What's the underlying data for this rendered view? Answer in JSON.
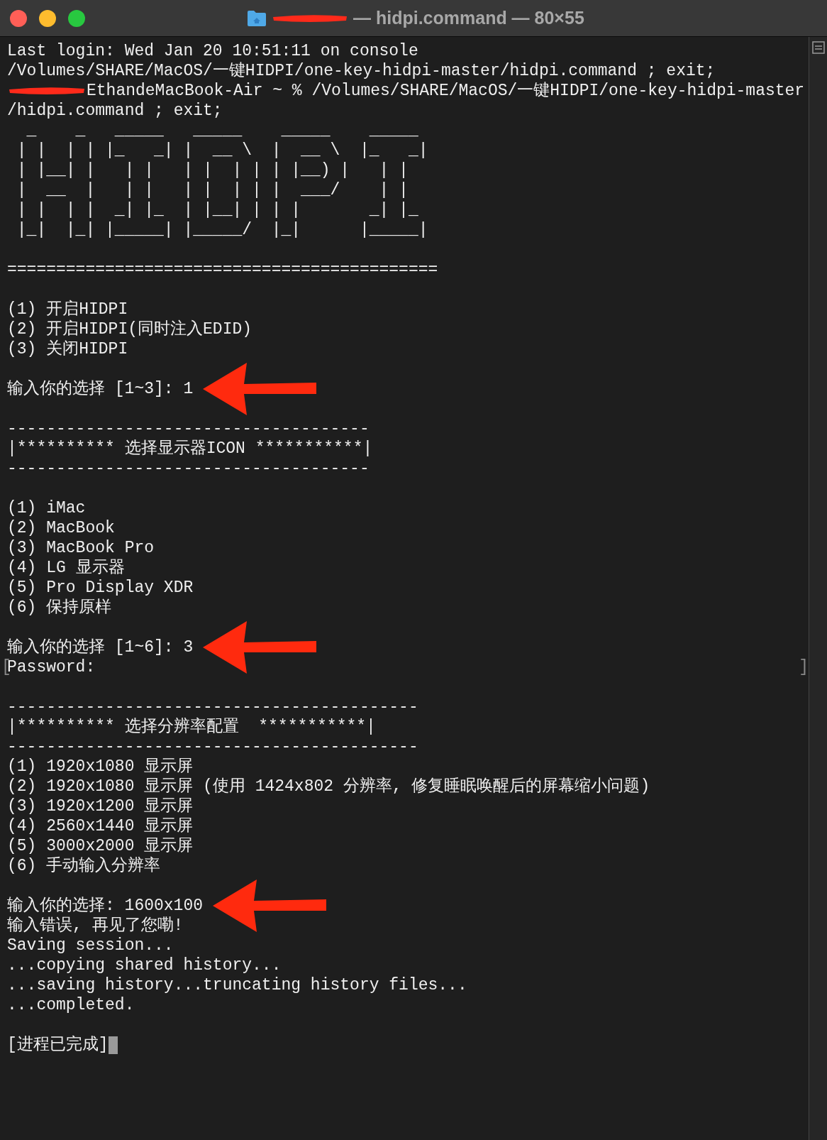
{
  "window": {
    "title": "— hidpi.command — 80×55",
    "title_redacted": true
  },
  "terminal": {
    "lines": [
      {
        "kind": "text",
        "text": "Last login: Wed Jan 20 10:51:11 on console"
      },
      {
        "kind": "text",
        "text": "/Volumes/SHARE/MacOS/一键HIDPI/one-key-hidpi-master/hidpi.command ; exit;"
      },
      {
        "kind": "redacted",
        "text": "EthandeMacBook-Air ~ % /Volumes/SHARE/MacOS/一键HIDPI/one-key-hidpi-master"
      },
      {
        "kind": "text",
        "text": "/hidpi.command ; exit;"
      },
      {
        "kind": "text",
        "text": "  _    _   _____   _____    _____    _____"
      },
      {
        "kind": "text",
        "text": " | |  | | |_   _| |  __ \\  |  __ \\  |_   _|"
      },
      {
        "kind": "text",
        "text": " | |__| |   | |   | |  | | | |__) |   | |"
      },
      {
        "kind": "text",
        "text": " |  __  |   | |   | |  | | |  ___/    | |"
      },
      {
        "kind": "text",
        "text": " | |  | |  _| |_  | |__| | | |       _| |_"
      },
      {
        "kind": "text",
        "text": " |_|  |_| |_____| |_____/  |_|      |_____|"
      },
      {
        "kind": "blank"
      },
      {
        "kind": "text",
        "text": "============================================"
      },
      {
        "kind": "blank"
      },
      {
        "kind": "text",
        "text": "(1) 开启HIDPI"
      },
      {
        "kind": "text",
        "text": "(2) 开启HIDPI(同时注入EDID)"
      },
      {
        "kind": "text",
        "text": "(3) 关闭HIDPI"
      },
      {
        "kind": "blank"
      },
      {
        "kind": "prompt",
        "text": "输入你的选择 [1~3]: 1"
      },
      {
        "kind": "blank"
      },
      {
        "kind": "text",
        "text": "-------------------------------------"
      },
      {
        "kind": "text",
        "text": "|********** 选择显示器ICON ***********|"
      },
      {
        "kind": "text",
        "text": "-------------------------------------"
      },
      {
        "kind": "blank"
      },
      {
        "kind": "text",
        "text": "(1) iMac"
      },
      {
        "kind": "text",
        "text": "(2) MacBook"
      },
      {
        "kind": "text",
        "text": "(3) MacBook Pro"
      },
      {
        "kind": "text",
        "text": "(4) LG 显示器"
      },
      {
        "kind": "text",
        "text": "(5) Pro Display XDR"
      },
      {
        "kind": "text",
        "text": "(6) 保持原样"
      },
      {
        "kind": "blank"
      },
      {
        "kind": "prompt",
        "text": "输入你的选择 [1~6]: 3"
      },
      {
        "kind": "marked",
        "text": "Password:",
        "mark_open": "[",
        "mark_close": "]"
      },
      {
        "kind": "blank"
      },
      {
        "kind": "text",
        "text": "------------------------------------------"
      },
      {
        "kind": "text",
        "text": "|********** 选择分辨率配置  ***********|"
      },
      {
        "kind": "text",
        "text": "------------------------------------------"
      },
      {
        "kind": "text",
        "text": "(1) 1920x1080 显示屏"
      },
      {
        "kind": "text",
        "text": "(2) 1920x1080 显示屏 (使用 1424x802 分辨率, 修复睡眠唤醒后的屏幕缩小问题)"
      },
      {
        "kind": "text",
        "text": "(3) 1920x1200 显示屏"
      },
      {
        "kind": "text",
        "text": "(4) 2560x1440 显示屏"
      },
      {
        "kind": "text",
        "text": "(5) 3000x2000 显示屏"
      },
      {
        "kind": "text",
        "text": "(6) 手动输入分辨率"
      },
      {
        "kind": "blank"
      },
      {
        "kind": "prompt",
        "text": "输入你的选择: 1600x100"
      },
      {
        "kind": "text",
        "text": "输入错误, 再见了您嘞!"
      },
      {
        "kind": "text",
        "text": "Saving session..."
      },
      {
        "kind": "text",
        "text": "...copying shared history..."
      },
      {
        "kind": "text",
        "text": "...saving history...truncating history files..."
      },
      {
        "kind": "text",
        "text": "...completed."
      },
      {
        "kind": "blank"
      },
      {
        "kind": "end",
        "text": "[进程已完成]"
      }
    ]
  }
}
